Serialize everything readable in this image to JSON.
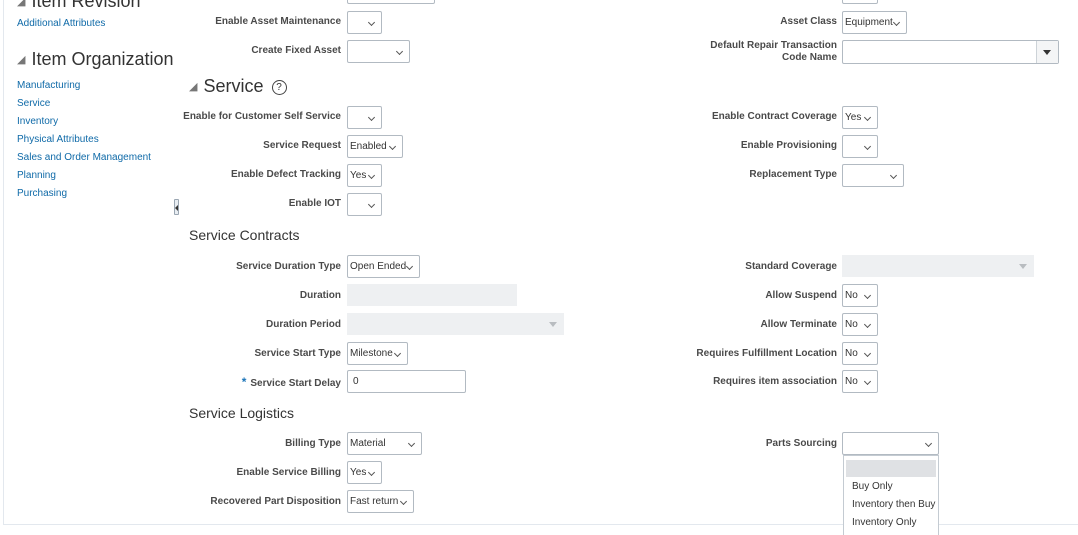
{
  "sidebar": {
    "item_revision_heading": "Item Revision",
    "item_revision_links": [
      "Additional Attributes"
    ],
    "item_organization_heading": "Item Organization",
    "item_organization_links": [
      "Manufacturing",
      "Service",
      "Inventory",
      "Physical Attributes",
      "Sales and Order Management",
      "Planning",
      "Purchasing"
    ]
  },
  "asset": {
    "enable_asset_maintenance": {
      "label": "Enable Asset Maintenance",
      "value": ""
    },
    "create_fixed_asset": {
      "label": "Create Fixed Asset",
      "value": ""
    },
    "asset_class": {
      "label": "Asset Class",
      "value": "Equipment"
    },
    "default_repair_transaction": {
      "label_line1": "Default Repair Transaction",
      "label_line2": "Code Name",
      "value": ""
    }
  },
  "service": {
    "heading": "Service",
    "help_icon": "?",
    "enable_customer_self_service": {
      "label": "Enable for Customer Self Service",
      "value": ""
    },
    "service_request": {
      "label": "Service Request",
      "value": "Enabled"
    },
    "enable_defect_tracking": {
      "label": "Enable Defect Tracking",
      "value": "Yes"
    },
    "enable_iot": {
      "label": "Enable IOT",
      "value": ""
    },
    "enable_contract_coverage": {
      "label": "Enable Contract Coverage",
      "value": "Yes"
    },
    "enable_provisioning": {
      "label": "Enable Provisioning",
      "value": ""
    },
    "replacement_type": {
      "label": "Replacement Type",
      "value": ""
    }
  },
  "service_contracts": {
    "heading": "Service Contracts",
    "service_duration_type": {
      "label": "Service Duration Type",
      "value": "Open Ended"
    },
    "duration": {
      "label": "Duration",
      "value": ""
    },
    "duration_period": {
      "label": "Duration Period",
      "value": ""
    },
    "service_start_type": {
      "label": "Service Start Type",
      "value": "Milestone"
    },
    "service_start_delay": {
      "label": "Service Start Delay",
      "required_mark": "*",
      "value": "0"
    },
    "standard_coverage": {
      "label": "Standard Coverage",
      "value": ""
    },
    "allow_suspend": {
      "label": "Allow Suspend",
      "value": "No"
    },
    "allow_terminate": {
      "label": "Allow Terminate",
      "value": "No"
    },
    "requires_fulfillment_location": {
      "label": "Requires Fulfillment Location",
      "value": "No"
    },
    "requires_item_association": {
      "label": "Requires item association",
      "value": "No"
    }
  },
  "service_logistics": {
    "heading": "Service Logistics",
    "billing_type": {
      "label": "Billing Type",
      "value": "Material"
    },
    "enable_service_billing": {
      "label": "Enable Service Billing",
      "value": "Yes"
    },
    "recovered_part_disposition": {
      "label": "Recovered Part Disposition",
      "value": "Fast return"
    },
    "parts_sourcing": {
      "label": "Parts Sourcing",
      "value": "",
      "options": [
        "",
        "Buy Only",
        "Inventory then Buy",
        "Inventory Only"
      ]
    }
  }
}
